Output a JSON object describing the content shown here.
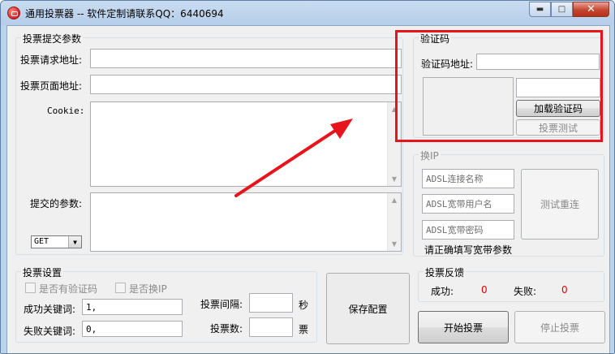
{
  "window": {
    "title": "通用投票器 -- 软件定制请联系QQ：6440694",
    "min_glyph": "▬",
    "max_glyph": "□",
    "close_glyph": "✕"
  },
  "submit_params": {
    "group_title": "投票提交参数",
    "request_url_label": "投票请求地址:",
    "request_url_value": "",
    "page_url_label": "投票页面地址:",
    "page_url_value": "",
    "cookie_label": "Cookie:",
    "params_label": "提交的参数:",
    "method_selected": "GET"
  },
  "captcha": {
    "group_title": "验证码",
    "url_label": "验证码地址:",
    "url_value": "",
    "code_value": "",
    "load_button": "加载验证码",
    "test_button": "投票测试"
  },
  "ip_switch": {
    "group_title": "换IP",
    "adsl_name_placeholder": "ADSL连接名称",
    "adsl_user_placeholder": "ADSL宽带用户名",
    "adsl_pass_placeholder": "ADSL宽带密码",
    "hint": "请正确填写宽带参数",
    "redial_button": "测试重连"
  },
  "vote_settings": {
    "group_title": "投票设置",
    "has_captcha_label": "是否有验证码",
    "switch_ip_label": "是否换IP",
    "success_keyword_label": "成功关键词:",
    "success_keyword_value": "1,",
    "fail_keyword_label": "失败关键词:",
    "fail_keyword_value": "0,",
    "interval_label": "投票间隔:",
    "interval_value": "",
    "interval_unit": "秒",
    "count_label": "投票数:",
    "count_value": "",
    "count_unit": "票"
  },
  "save_button": "保存配置",
  "feedback": {
    "group_title": "投票反馈",
    "success_label": "成功:",
    "success_value": "0",
    "fail_label": "失败:",
    "fail_value": "0"
  },
  "start_button": "开始投票",
  "stop_button": "停止投票",
  "colors": {
    "annotation_red": "#e8141c",
    "counter_red": "#e00000"
  }
}
